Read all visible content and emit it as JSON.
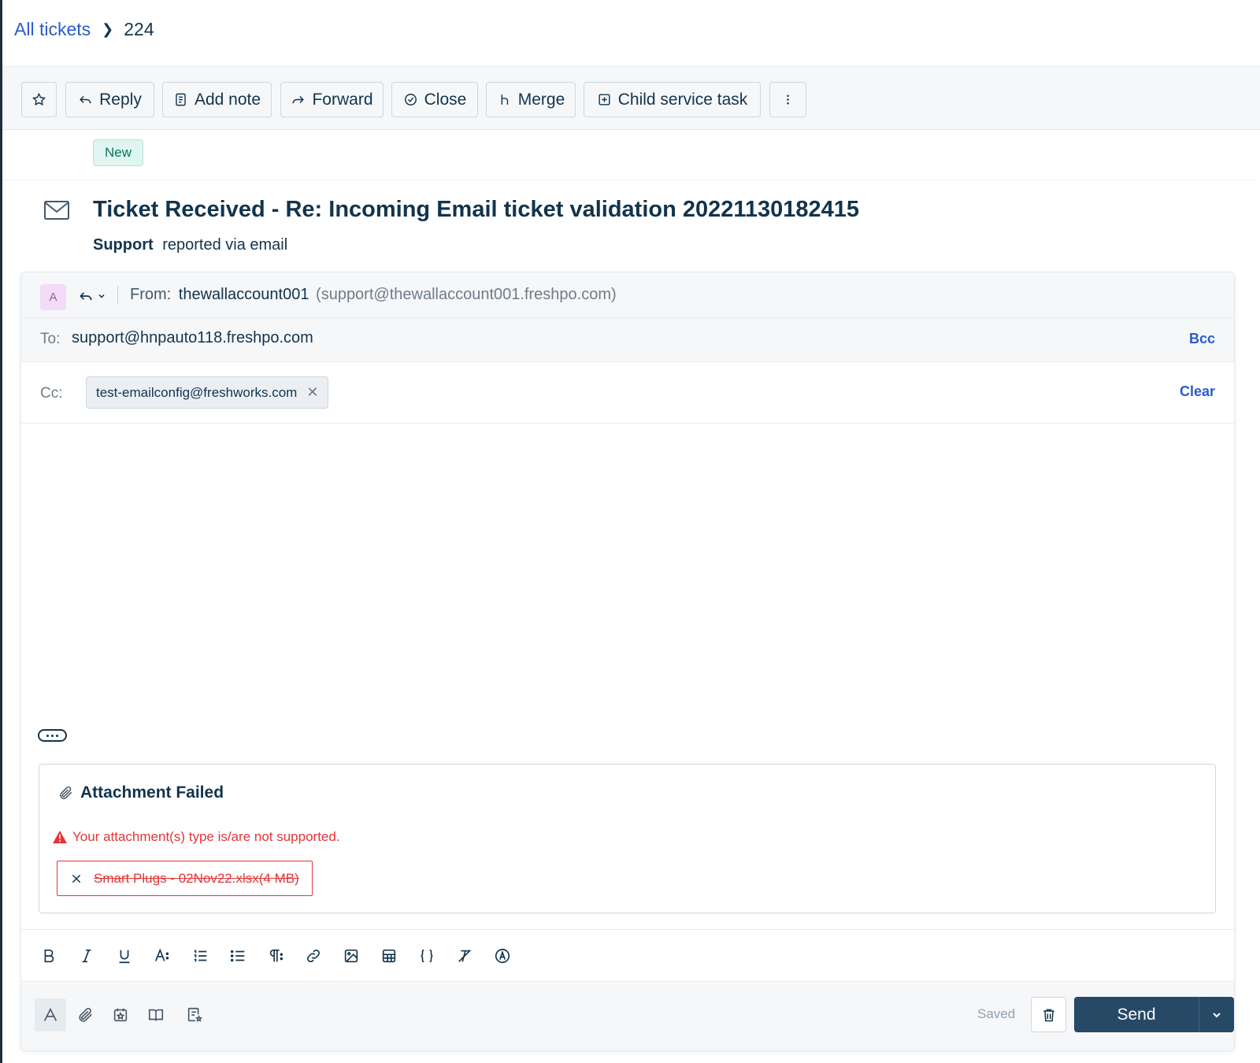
{
  "breadcrumb": {
    "root": "All tickets",
    "current": "224"
  },
  "toolbar": {
    "reply": "Reply",
    "add_note": "Add note",
    "forward": "Forward",
    "close": "Close",
    "merge": "Merge",
    "child_task": "Child service task"
  },
  "ticket": {
    "status": "New",
    "title": "Ticket Received - Re: Incoming Email ticket validation 20221130182415",
    "reporter": "Support",
    "reported_via": "reported via email"
  },
  "composer": {
    "avatar_initial": "A",
    "from_label": "From:",
    "from_name": "thewallaccount001",
    "from_address": "(support@thewallaccount001.freshpo.com)",
    "to_label": "To:",
    "to_value": "support@hnpauto118.freshpo.com",
    "bcc_label": "Bcc",
    "cc_label": "Cc:",
    "cc_chip": "test-emailconfig@freshworks.com",
    "clear_label": "Clear"
  },
  "attachment": {
    "title": "Attachment Failed",
    "error": "Your attachment(s) type is/are not supported.",
    "file": "Smart Plugs - 02Nov22.xlsx(4 MB)"
  },
  "footer": {
    "saved_label": "Saved",
    "send_label": "Send"
  },
  "colors": {
    "link": "#2c5cc5",
    "primary": "#264966",
    "error": "#e43538",
    "badge_bg": "#e0f5f0",
    "badge_text": "#00795b"
  }
}
